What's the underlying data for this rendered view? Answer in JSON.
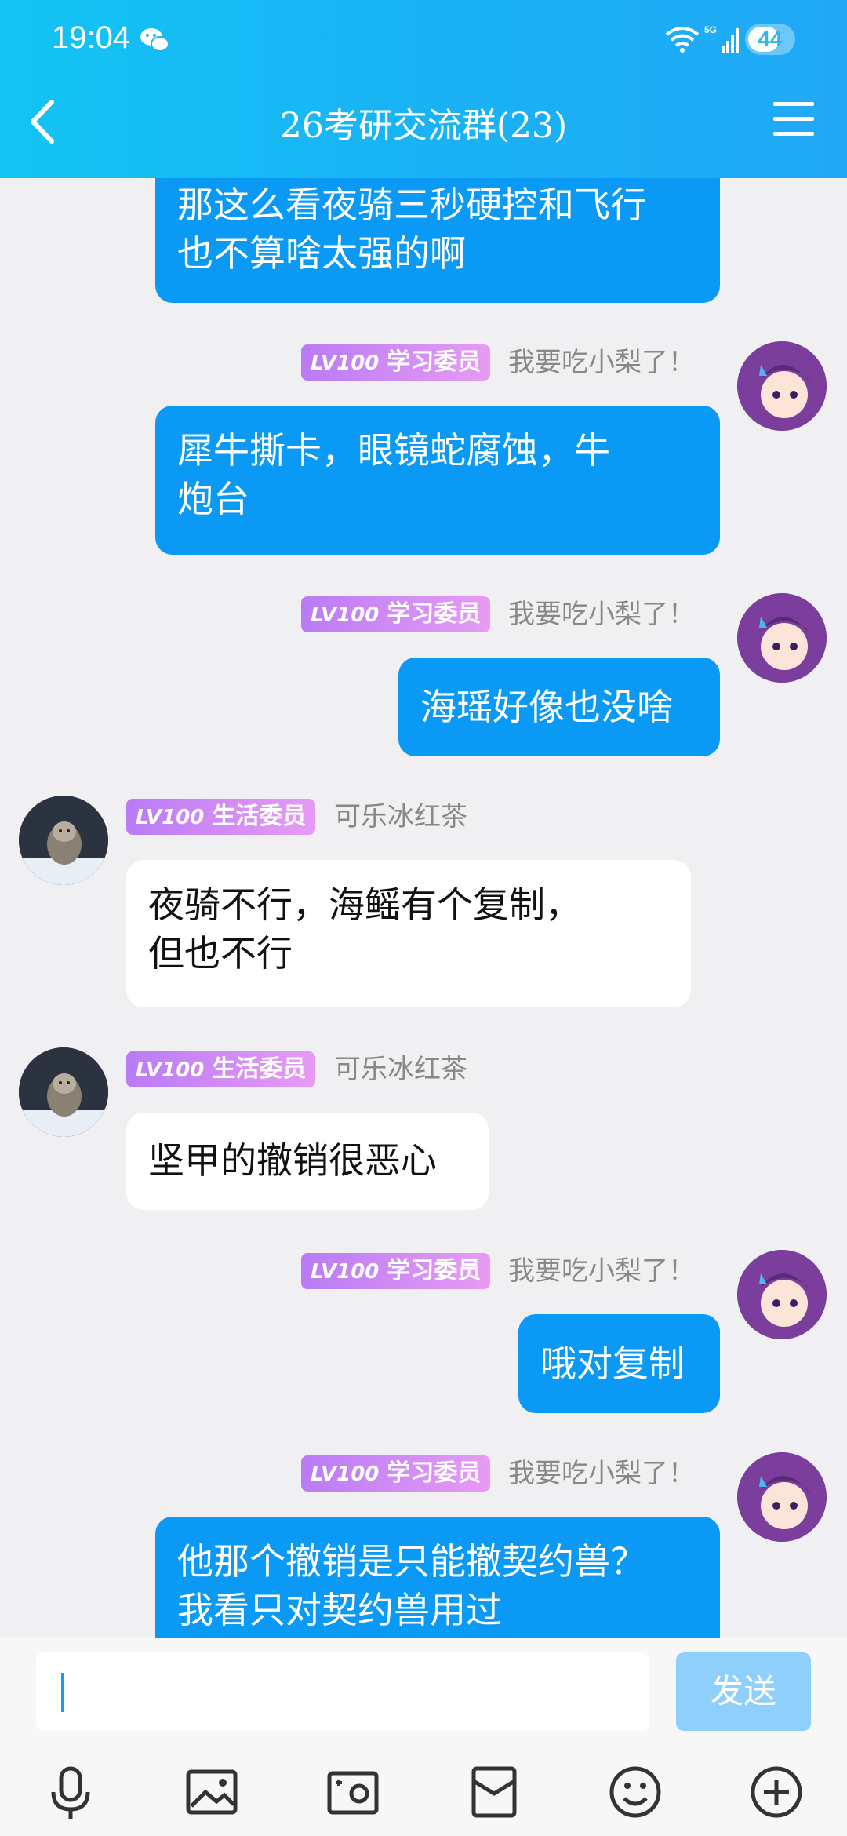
{
  "status": {
    "time": "19:04",
    "battery": "44"
  },
  "header": {
    "title": "26考研交流群(23)"
  },
  "messages": [
    {
      "side": "out",
      "text": "那这么看夜骑三秒硬控和飞行\n也不算啥太强的啊"
    },
    {
      "side": "out",
      "badge_level": "LV100",
      "badge_title": "学习委员",
      "sender": "我要吃小梨了！",
      "text": "犀牛撕卡，眼镜蛇腐蚀，牛\n炮台"
    },
    {
      "side": "out",
      "badge_level": "LV100",
      "badge_title": "学习委员",
      "sender": "我要吃小梨了！",
      "text": "海瑶好像也没啥"
    },
    {
      "side": "in",
      "badge_level": "LV100",
      "badge_title": "生活委员",
      "sender": "可乐冰红茶",
      "text": "夜骑不行，海鳐有个复制，\n但也不行"
    },
    {
      "side": "in",
      "badge_level": "LV100",
      "badge_title": "生活委员",
      "sender": "可乐冰红茶",
      "text": "坚甲的撤销很恶心"
    },
    {
      "side": "out",
      "badge_level": "LV100",
      "badge_title": "学习委员",
      "sender": "我要吃小梨了！",
      "text": "哦对复制"
    },
    {
      "side": "out",
      "badge_level": "LV100",
      "badge_title": "学习委员",
      "sender": "我要吃小梨了！",
      "text": "他那个撤销是只能撤契约兽？\n我看只对契约兽用过"
    }
  ],
  "input": {
    "value": "",
    "send_label": "发送"
  },
  "toolbar": [
    "microphone-icon",
    "image-icon",
    "camera-icon",
    "red-packet-icon",
    "emoji-icon",
    "plus-icon"
  ]
}
